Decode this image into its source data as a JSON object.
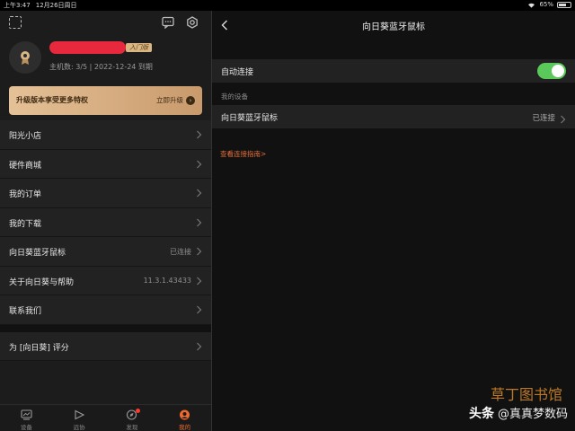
{
  "status": {
    "time": "上午3:47",
    "date": "12月26日周日",
    "battery": "65%",
    "battery_level": 0.65
  },
  "left": {
    "role_badge": "入门版",
    "host_info": "主机数: 3/5 | 2022-12-24 到期",
    "upgrade": {
      "text": "升级版本享受更多特权",
      "cta": "立即升级"
    },
    "menu": [
      {
        "label": "阳光小店",
        "value": ""
      },
      {
        "label": "硬件商城",
        "value": ""
      },
      {
        "label": "我的订单",
        "value": ""
      },
      {
        "label": "我的下载",
        "value": ""
      },
      {
        "label": "向日葵蓝牙鼠标",
        "value": "已连接"
      },
      {
        "label": "关于向日葵与帮助",
        "value": "11.3.1.43433"
      },
      {
        "label": "联系我们",
        "value": ""
      },
      {
        "label": "为 [向日葵] 评分",
        "value": ""
      }
    ],
    "tabs": [
      {
        "label": "设备",
        "icon": "device-icon"
      },
      {
        "label": "远协",
        "icon": "remote-assist-icon"
      },
      {
        "label": "发现",
        "icon": "compass-icon"
      },
      {
        "label": "我的",
        "icon": "profile-icon"
      }
    ]
  },
  "right": {
    "title": "向日葵蓝牙鼠标",
    "auto_connect": {
      "label": "自动连接",
      "enabled": true
    },
    "section_label": "我的设备",
    "device": {
      "label": "向日葵蓝牙鼠标",
      "status": "已连接"
    },
    "guide_link": "查看连接指南>"
  },
  "watermark": {
    "line1": "头条",
    "line2": "@真真梦数码",
    "line3": "草丁图书馆"
  },
  "colors": {
    "accent": "#f06a2e",
    "toggle_on": "#5ac85a",
    "gold": "#d9b684"
  }
}
